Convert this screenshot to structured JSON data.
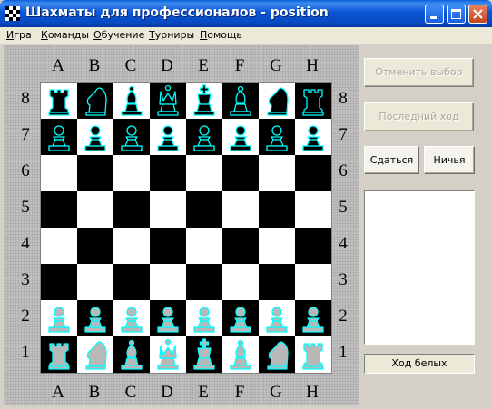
{
  "window": {
    "title": "Шахматы для профессионалов - position"
  },
  "menu": {
    "items": [
      "Игра",
      "Команды",
      "Обучение",
      "Турниры",
      "Помощь"
    ]
  },
  "board": {
    "files": [
      "A",
      "B",
      "C",
      "D",
      "E",
      "F",
      "G",
      "H"
    ],
    "ranks": [
      "8",
      "7",
      "6",
      "5",
      "4",
      "3",
      "2",
      "1"
    ],
    "position": [
      [
        "bR",
        "bN",
        "bB",
        "bQ",
        "bK",
        "bB",
        "bN",
        "bR"
      ],
      [
        "bP",
        "bP",
        "bP",
        "bP",
        "bP",
        "bP",
        "bP",
        "bP"
      ],
      [
        "",
        "",
        "",
        "",
        "",
        "",
        "",
        ""
      ],
      [
        "",
        "",
        "",
        "",
        "",
        "",
        "",
        ""
      ],
      [
        "",
        "",
        "",
        "",
        "",
        "",
        "",
        ""
      ],
      [
        "",
        "",
        "",
        "",
        "",
        "",
        "",
        ""
      ],
      [
        "wP",
        "wP",
        "wP",
        "wP",
        "wP",
        "wP",
        "wP",
        "wP"
      ],
      [
        "wR",
        "wN",
        "wB",
        "wQ",
        "wK",
        "wB",
        "wN",
        "wR"
      ]
    ],
    "colors": {
      "light_square": "#ffffff",
      "dark_square": "#000000",
      "black_piece_fill": "#000000",
      "black_piece_outline": "#00ffff",
      "white_piece_fill": "#b8b8b8",
      "white_piece_outline": "#00ffff"
    }
  },
  "panel": {
    "undo_label": "Отменить выбор",
    "last_move_label": "Последний ход",
    "resign_label": "Сдаться",
    "draw_label": "Ничья",
    "status_text": "Ход белых"
  }
}
